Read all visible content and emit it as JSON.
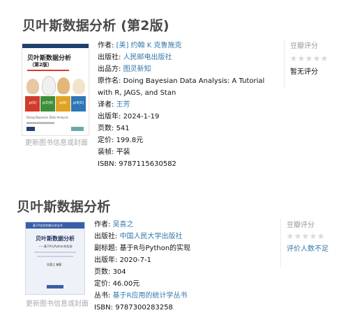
{
  "books": [
    {
      "title": "贝叶斯数据分析 (第2版)",
      "cover": {
        "title_line1": "贝叶斯数据分析",
        "title_line2": "（第2版）",
        "panel_labels": [
          "p(D)",
          "p(D|θ)",
          "p(θ)",
          "p(θ|D)"
        ],
        "subtitle_en": "Doing Bayesian Data Analysis"
      },
      "update_link": "更新图书信息或封面",
      "info": {
        "author_label": "作者:",
        "author_value": "[美] 约翰 K 克鲁施克",
        "publisher_label": "出版社:",
        "publisher_value": "人民邮电出版社",
        "producer_label": "出品方:",
        "producer_value": "图灵新知",
        "original_label": "原作名:",
        "original_value": "Doing Bayesian Data Analysis: A Tutorial with R, JAGS, and Stan",
        "translator_label": "译者:",
        "translator_value": "王芳",
        "pubyear_label": "出版年:",
        "pubyear_value": "2024-1-19",
        "pages_label": "页数:",
        "pages_value": "541",
        "price_label": "定价:",
        "price_value": "199.8元",
        "binding_label": "装帧:",
        "binding_value": "平装",
        "isbn_label": "ISBN:",
        "isbn_value": "9787115630582"
      },
      "rating": {
        "title": "豆瓣评分",
        "stars": 0,
        "note": "暂无评分"
      }
    },
    {
      "title": "贝叶斯数据分析",
      "cover": {
        "series_label": "基于R应用的统计学丛书",
        "title": "贝叶斯数据分析",
        "subtitle": "——基于R与Python的实现",
        "author": "吴喜之 编著"
      },
      "update_link": "更新图书信息或封面",
      "info": {
        "author_label": "作者:",
        "author_value": "吴喜之",
        "publisher_label": "出版社:",
        "publisher_value": "中国人民大学出版社",
        "subtitle_label": "副标题:",
        "subtitle_value": "基于R与Python的实现",
        "pubyear_label": "出版年:",
        "pubyear_value": "2020-7-1",
        "pages_label": "页数:",
        "pages_value": "304",
        "price_label": "定价:",
        "price_value": "46.00元",
        "series_label": "丛书:",
        "series_value": "基于R应用的统计学丛书",
        "isbn_label": "ISBN:",
        "isbn_value": "9787300283258"
      },
      "rating": {
        "title": "豆瓣评分",
        "stars": 0,
        "note": "评价人数不足"
      }
    }
  ],
  "colors": {
    "link": "#3377aa",
    "title": "#494949",
    "muted": "#9b9b9b",
    "star_empty": "#d9d9d9"
  }
}
